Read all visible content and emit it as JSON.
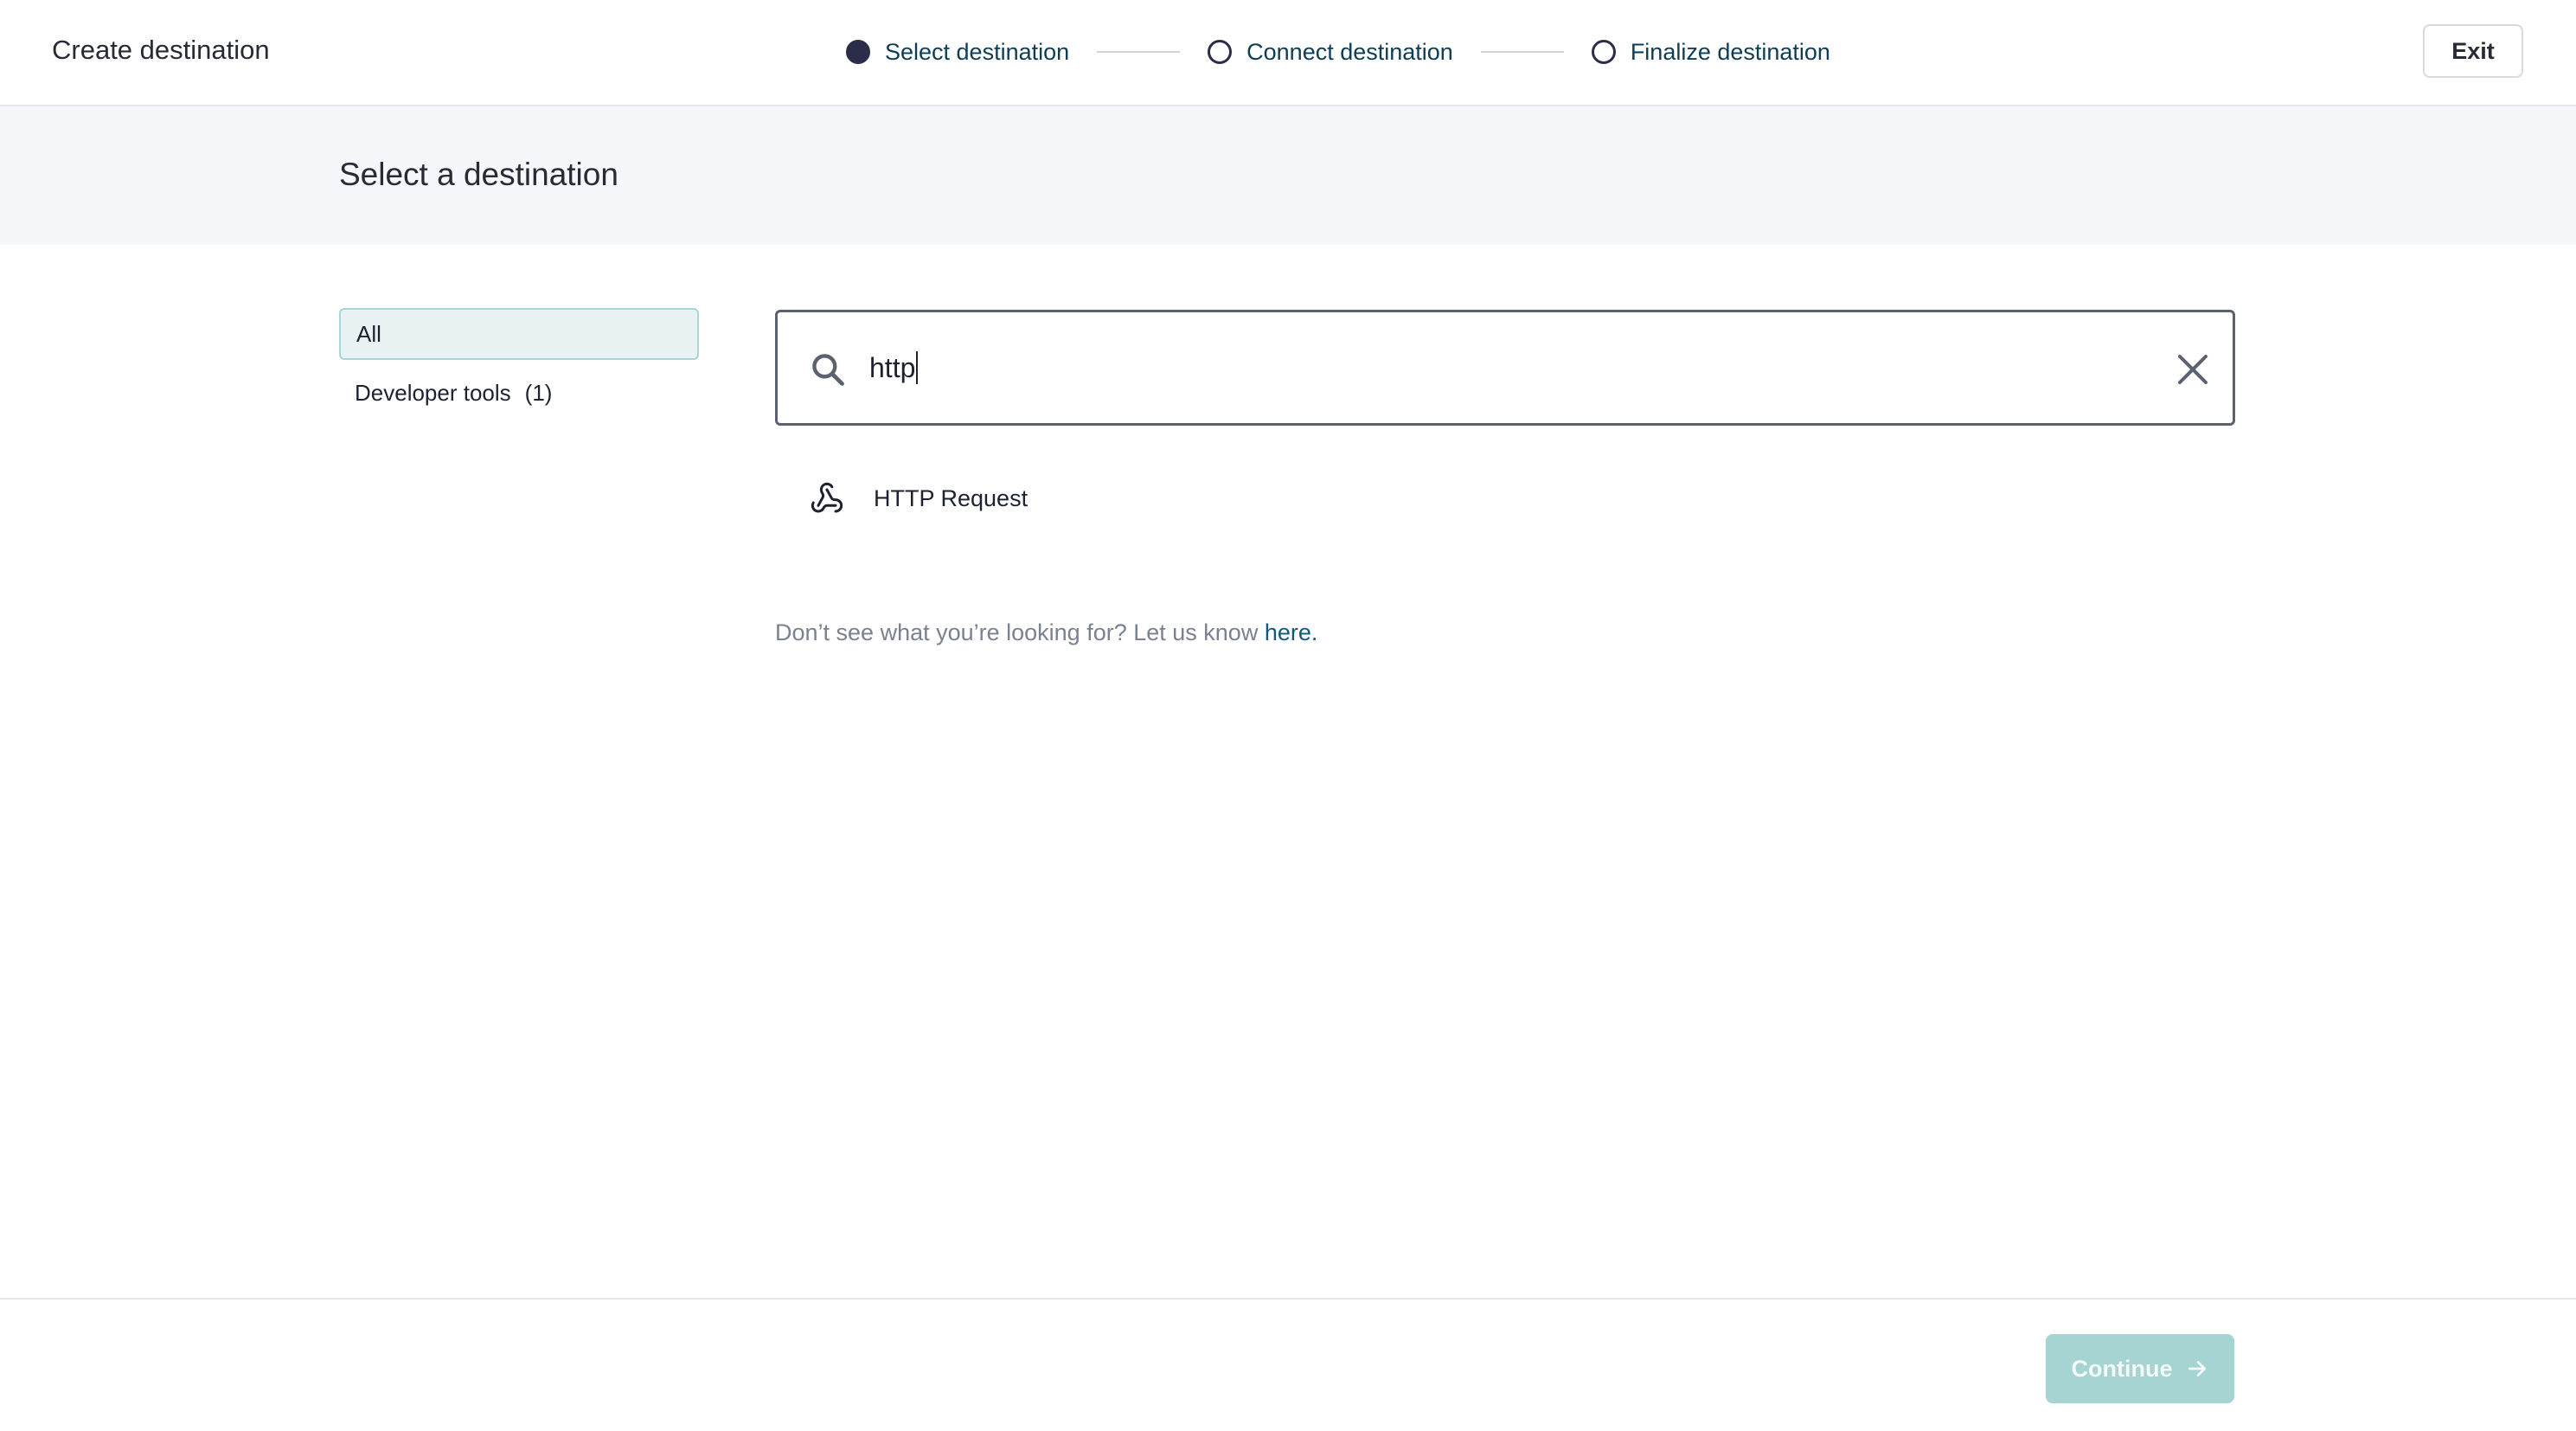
{
  "header": {
    "title": "Create destination",
    "steps": [
      {
        "label": "Select destination",
        "state": "active"
      },
      {
        "label": "Connect destination",
        "state": "pending"
      },
      {
        "label": "Finalize destination",
        "state": "pending"
      }
    ],
    "exit_label": "Exit"
  },
  "banner": {
    "heading": "Select a destination"
  },
  "categories": [
    {
      "label": "All",
      "count": "",
      "selected": true
    },
    {
      "label": "Developer tools",
      "count": "(1)",
      "selected": false
    }
  ],
  "search": {
    "value": "http",
    "icon": "search-icon",
    "clear_icon": "close-icon"
  },
  "results": [
    {
      "label": "HTTP Request",
      "icon": "webhook-icon"
    }
  ],
  "hint": {
    "text": "Don’t see what you’re looking for? Let us know ",
    "link": "here."
  },
  "footer": {
    "continue_label": "Continue",
    "continue_enabled": false
  },
  "colors": {
    "accent": "#2b2d4a",
    "step_text": "#0e3d54",
    "selected_bg": "#e9f3f3",
    "selected_border": "#a9d6d6",
    "continue_disabled": "#a5d4d3",
    "link": "#0e5a7c"
  }
}
